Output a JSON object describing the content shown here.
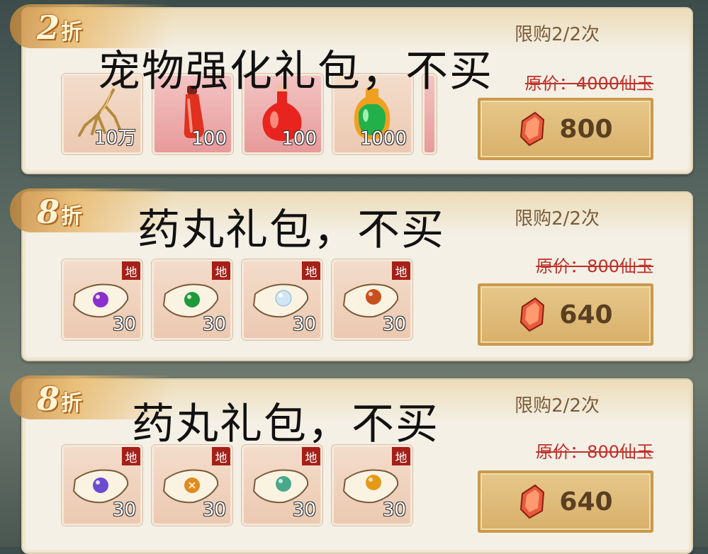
{
  "packs": [
    {
      "discount_num": "2",
      "discount_suffix": "折",
      "overlay": "宠物强化礼包，不买",
      "limit": "限购2/2次",
      "original_price": "原价：4000仙玉",
      "price": "800",
      "items": [
        {
          "icon": "ginseng-icon",
          "qty": "10万"
        },
        {
          "icon": "red-potion-icon",
          "qty": "100"
        },
        {
          "icon": "red-flask-icon",
          "qty": "100"
        },
        {
          "icon": "green-potion-icon",
          "qty": "1000"
        }
      ]
    },
    {
      "discount_num": "8",
      "discount_suffix": "折",
      "overlay": "药丸礼包，不买",
      "limit": "限购2/2次",
      "original_price": "原价：800仙玉",
      "price": "640",
      "items": [
        {
          "icon": "purple-pill-icon",
          "qty": "30",
          "tag": "地",
          "color": "#8a2fd0"
        },
        {
          "icon": "green-pill-icon",
          "qty": "30",
          "tag": "地",
          "color": "#1e9a3a"
        },
        {
          "icon": "white-pill-icon",
          "qty": "30",
          "tag": "地",
          "color": "#cfe6f5"
        },
        {
          "icon": "orange-pill-icon",
          "qty": "30",
          "tag": "地",
          "color": "#c8501c"
        }
      ]
    },
    {
      "discount_num": "8",
      "discount_suffix": "折",
      "overlay": "药丸礼包，不买",
      "limit": "限购2/2次",
      "original_price": "原价：800仙玉",
      "price": "640",
      "items": [
        {
          "icon": "violet-pill-icon",
          "qty": "30",
          "tag": "地",
          "color": "#6a4cd0"
        },
        {
          "icon": "amber-pill-icon",
          "qty": "30",
          "tag": "地",
          "color": "#e08a20"
        },
        {
          "icon": "teal-pill-icon",
          "qty": "30",
          "tag": "地",
          "color": "#4aa88a"
        },
        {
          "icon": "gold-pill-icon",
          "qty": "30",
          "tag": "地",
          "color": "#e49a18"
        }
      ]
    }
  ],
  "colors": {
    "discount_text": "#fff4d6",
    "original_price": "#c0302a",
    "buy_button": "#d8b06a",
    "tag": "#a52018"
  }
}
